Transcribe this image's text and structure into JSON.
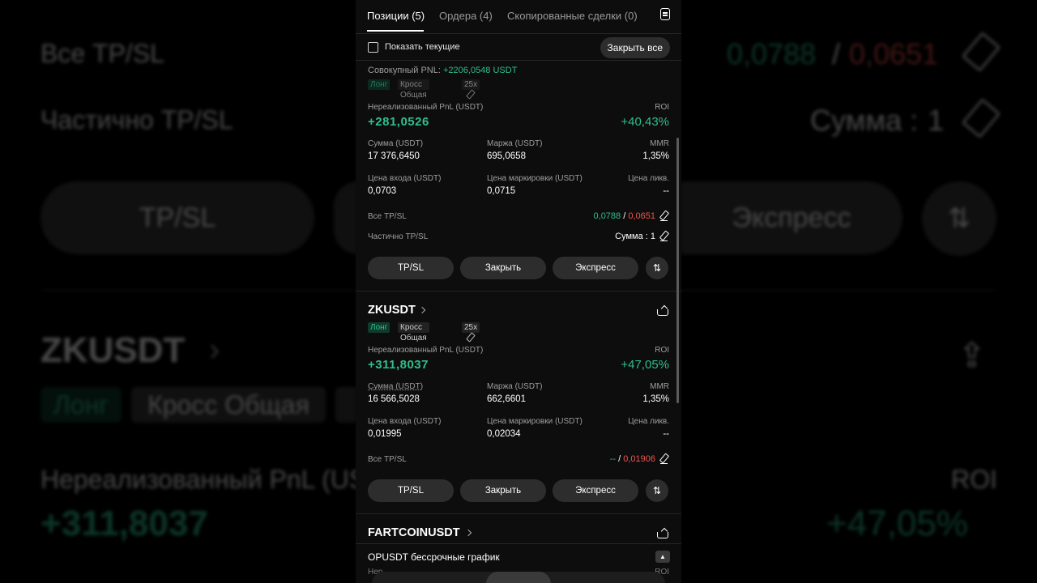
{
  "tabs": [
    {
      "label": "Позиции (5)"
    },
    {
      "label": "Ордера (4)"
    },
    {
      "label": "Скопированные сделки (0)"
    }
  ],
  "filter": {
    "show_current_label": "Показать текущие",
    "close_all_label": "Закрыть все"
  },
  "summary": {
    "total_pnl_label": "Совокупный PNL:",
    "total_pnl_value": "+2206,0548 USDT"
  },
  "positions": [
    {
      "symbol": "",
      "tags": {
        "side": "Лонг",
        "margin_mode": "Кросс Общая",
        "leverage": "25x"
      },
      "unrealized_pnl_label": "Нереализованный PnL (USDT)",
      "unrealized_pnl_value": "+281,0526",
      "roi_label": "ROI",
      "roi_value": "+40,43%",
      "amount_label": "Сумма (USDT)",
      "amount_value": "17 376,6450",
      "margin_label": "Маржа (USDT)",
      "margin_value": "695,0658",
      "mmr_label": "MMR",
      "mmr_value": "1,35%",
      "entry_label": "Цена входа (USDT)",
      "entry_value": "0,0703",
      "mark_label": "Цена маркировки (USDT)",
      "mark_value": "0,0715",
      "liq_label": "Цена ликв.",
      "liq_value": "--",
      "tpsl_label": "Все TP/SL",
      "tp_value": "0,0788",
      "sl_value": "0,0651",
      "partial_label": "Частично TP/SL",
      "partial_amount_label": "Сумма :",
      "partial_amount_value": "1",
      "btn_tpsl": "TP/SL",
      "btn_close": "Закрыть",
      "btn_express": "Экспресс"
    },
    {
      "symbol": "ZKUSDT",
      "tags": {
        "side": "Лонг",
        "margin_mode": "Кросс Общая",
        "leverage": "25x"
      },
      "unrealized_pnl_label": "Нереализованный PnL (USDT)",
      "unrealized_pnl_value": "+311,8037",
      "roi_label": "ROI",
      "roi_value": "+47,05%",
      "amount_label": "Сумма (USDT)",
      "amount_value": "16 566,5028",
      "margin_label": "Маржа (USDT)",
      "margin_value": "662,6601",
      "mmr_label": "MMR",
      "mmr_value": "1,35%",
      "entry_label": "Цена входа (USDT)",
      "entry_value": "0,01995",
      "mark_label": "Цена маркировки (USDT)",
      "mark_value": "0,02034",
      "liq_label": "Цена ликв.",
      "liq_value": "--",
      "tpsl_label": "Все TP/SL",
      "tp_value": "--",
      "sl_value": "0,01906",
      "btn_tpsl": "TP/SL",
      "btn_close": "Закрыть",
      "btn_express": "Экспресс"
    },
    {
      "symbol": "FARTCOINUSDT"
    }
  ],
  "chart_bar": {
    "title": "OPUSDT бессрочные график",
    "peek_left": "Нер",
    "peek_right": "ROI"
  },
  "colors": {
    "green": "#2fbf8b",
    "red": "#f0554f",
    "panel": "#0d0d0d",
    "button": "#2d2d2d"
  },
  "icons": [
    "document-icon",
    "edit-icon",
    "chevron-right-icon",
    "share-icon",
    "swap-icon",
    "chevron-up-icon"
  ]
}
